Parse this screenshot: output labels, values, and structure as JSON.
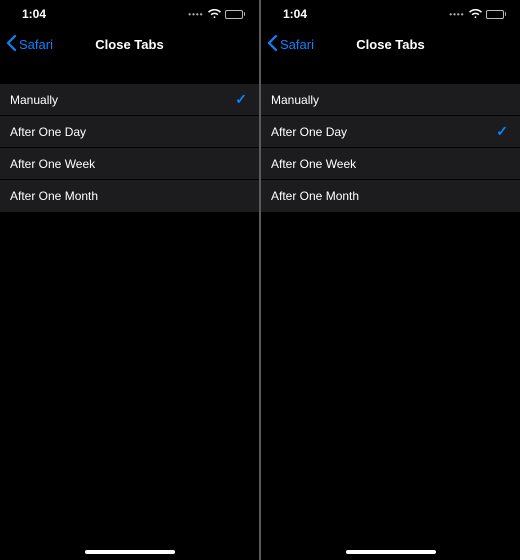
{
  "accent": "#0a84ff",
  "screens": [
    {
      "statusTime": "1:04",
      "backLabel": "Safari",
      "title": "Close Tabs",
      "options": [
        {
          "label": "Manually",
          "selected": true
        },
        {
          "label": "After One Day",
          "selected": false
        },
        {
          "label": "After One Week",
          "selected": false
        },
        {
          "label": "After One Month",
          "selected": false
        }
      ]
    },
    {
      "statusTime": "1:04",
      "backLabel": "Safari",
      "title": "Close Tabs",
      "options": [
        {
          "label": "Manually",
          "selected": false
        },
        {
          "label": "After One Day",
          "selected": true
        },
        {
          "label": "After One Week",
          "selected": false
        },
        {
          "label": "After One Month",
          "selected": false
        }
      ]
    }
  ]
}
